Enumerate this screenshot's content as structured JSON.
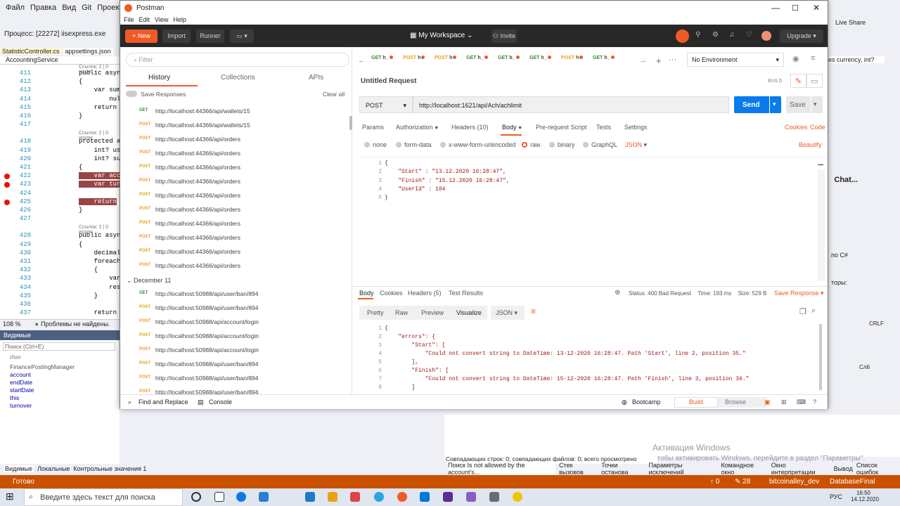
{
  "vs": {
    "menu": [
      "Файл",
      "Правка",
      "Вид",
      "Git",
      "Проект"
    ],
    "process": "Процесс: [22272] iisexpress.exe",
    "tabs": [
      "StatisticController.cs",
      "appsettings.json"
    ],
    "service": "AccountingService",
    "code_lines": [
      {
        "n": "411",
        "t": "public async"
      },
      {
        "n": "412",
        "t": "{"
      },
      {
        "n": "413",
        "t": "    var sum"
      },
      {
        "n": "414",
        "t": "        nul"
      },
      {
        "n": "415",
        "t": "    return"
      },
      {
        "n": "416",
        "t": "}"
      },
      {
        "n": "417",
        "t": ""
      },
      {
        "n": "418",
        "t": "protected a"
      },
      {
        "n": "419",
        "t": "    int? use"
      },
      {
        "n": "420",
        "t": "    int? suc"
      },
      {
        "n": "421",
        "t": "{"
      },
      {
        "n": "422",
        "t": "    var acc"
      },
      {
        "n": "423",
        "t": "    var turi"
      },
      {
        "n": "424",
        "t": ""
      },
      {
        "n": "425",
        "t": "    return"
      },
      {
        "n": "426",
        "t": "}"
      },
      {
        "n": "427",
        "t": ""
      },
      {
        "n": "428",
        "t": "public asyn"
      },
      {
        "n": "429",
        "t": "{"
      },
      {
        "n": "430",
        "t": "    decimal"
      },
      {
        "n": "431",
        "t": "    foreach"
      },
      {
        "n": "432",
        "t": "    {"
      },
      {
        "n": "433",
        "t": "        var"
      },
      {
        "n": "434",
        "t": "        res"
      },
      {
        "n": "435",
        "t": "    }"
      },
      {
        "n": "436",
        "t": ""
      },
      {
        "n": "437",
        "t": "    return"
      }
    ],
    "codelens": "Ссылок: 2 | 0 исклю",
    "zoom": "108 %",
    "no_problems": "Проблемы не найдены.",
    "watch_title": "Видимые",
    "watch_search": "Поиск (Ctrl+E)",
    "watch_col": "Имя",
    "watch_items": [
      "FinancePostingManager",
      "account",
      "endDate",
      "startDate",
      "this",
      "turnover"
    ],
    "bottom_tabs": [
      "Видимые",
      "Локальные",
      "Контрольные значения 1"
    ],
    "bottom_tabs_right": [
      "Стек вызовов",
      "Точки останова",
      "Параметры исключений",
      "Командное окно",
      "Окно интерпретации",
      "Вывод",
      "Список ошибок"
    ],
    "find_results": "Совпадающих строк: 0; совпадающих файлов: 0; всего просмотрено файлов: 128",
    "find_label": "Поиск Is not allowed by the account's...",
    "status_ready": "Готово",
    "status_items": [
      "↑ 0",
      "✎ 28",
      "bitcoinalley_dev",
      "DatabaseFinal"
    ],
    "right_text": [
      "es currency, int?",
      "Chat...",
      "по C#",
      "торы:",
      "CRLF",
      "Сл6"
    ],
    "live_share": "Live Share",
    "activation_title": "Активация Windows",
    "activation_sub": "Чтобы активировать Windows, перейдите в раздел \"Параметры\"."
  },
  "taskbar": {
    "search_placeholder": "Введите здесь текст для поиска",
    "lang": "РУС",
    "time": "16:50",
    "date": "14.12.2020"
  },
  "postman": {
    "window_title": "Postman",
    "menu": [
      "File",
      "Edit",
      "View",
      "Help"
    ],
    "new_label": "New",
    "import_label": "Import",
    "runner_label": "Runner",
    "workspace": "My Workspace",
    "invite": "Invite",
    "upgrade": "Upgrade",
    "filter_placeholder": "Filter",
    "sidebar_tabs": [
      "History",
      "Collections",
      "APIs"
    ],
    "save_responses": "Save Responses",
    "clear_all": "Clear all",
    "history": [
      {
        "method": "GET",
        "url": "http://localhost:44366/api/wallets/15"
      },
      {
        "method": "POST",
        "url": "http://localhost:44366/api/wallets/15"
      },
      {
        "method": "POST",
        "url": "http://localhost:44366/api/orders"
      },
      {
        "method": "POST",
        "url": "http://localhost:44366/api/orders"
      },
      {
        "method": "POST",
        "url": "http://localhost:44366/api/orders"
      },
      {
        "method": "POST",
        "url": "http://localhost:44366/api/orders"
      },
      {
        "method": "POST",
        "url": "http://localhost:44366/api/orders"
      },
      {
        "method": "POST",
        "url": "http://localhost:44366/api/orders"
      },
      {
        "method": "POST",
        "url": "http://localhost:44366/api/orders"
      },
      {
        "method": "POST",
        "url": "http://localhost:44366/api/orders"
      },
      {
        "method": "POST",
        "url": "http://localhost:44366/api/orders"
      },
      {
        "method": "POST",
        "url": "http://localhost:44366/api/orders"
      }
    ],
    "history_group": "December 11",
    "history2": [
      {
        "method": "GET",
        "url": "http://localhost:50988/api/user/ban/894"
      },
      {
        "method": "POST",
        "url": "http://localhost:50988/api/user/ban/894"
      },
      {
        "method": "POST",
        "url": "http://localhost:50988/api/account/login"
      },
      {
        "method": "POST",
        "url": "http://localhost:50988/api/account/login"
      },
      {
        "method": "POST",
        "url": "http://localhost:50988/api/account/login"
      },
      {
        "method": "POST",
        "url": "http://localhost:50988/api/user/ban/894"
      },
      {
        "method": "POST",
        "url": "http://localhost:50988/api/user/ban/894"
      },
      {
        "method": "POST",
        "url": "http://localhost:50988/api/user/ban/894"
      }
    ],
    "req_tabs": [
      {
        "m": "GET",
        "l": "h_"
      },
      {
        "m": "POST",
        "l": "h"
      },
      {
        "m": "POST",
        "l": "h"
      },
      {
        "m": "GET",
        "l": "h_"
      },
      {
        "m": "GET",
        "l": "b_"
      },
      {
        "m": "GET",
        "l": "h_"
      },
      {
        "m": "POST",
        "l": "h"
      },
      {
        "m": "GET",
        "l": "h_"
      }
    ],
    "environment": "No Environment",
    "request_name": "Untitled Request",
    "build": "BUILD",
    "method": "POST",
    "url": "http://localhost:1621/api/Ach/achlimit",
    "send": "Send",
    "save": "Save",
    "request_tabs": [
      "Params",
      "Authorization",
      "Headers (10)",
      "Body",
      "Pre-request Script",
      "Tests",
      "Settings"
    ],
    "cookies": "Cookies",
    "code": "Code",
    "body_types": [
      "none",
      "form-data",
      "x-www-form-urlencoded",
      "raw",
      "binary",
      "GraphQL"
    ],
    "body_format": "JSON",
    "beautify": "Beautify",
    "request_body": [
      {
        "n": "1",
        "t": "{"
      },
      {
        "n": "2",
        "t": "    \"Start\" : \"13.12.2020 16:28:47\","
      },
      {
        "n": "3",
        "t": "    \"Finish\" : \"15.12.2020 16:28:47\","
      },
      {
        "n": "4",
        "t": "    \"UserId\" : 104"
      },
      {
        "n": "5",
        "t": "}"
      }
    ],
    "response_tabs": [
      "Body",
      "Cookies",
      "Headers (5)",
      "Test Results"
    ],
    "status": "Status: 400 Bad Request",
    "time": "Time: 193 ms",
    "size": "Size: 529 B",
    "save_response": "Save Response",
    "view_modes": [
      "Pretty",
      "Raw",
      "Preview",
      "Visualize"
    ],
    "response_format": "JSON",
    "response_body": [
      {
        "n": "1",
        "t": "{"
      },
      {
        "n": "2",
        "t": "    \"errors\": {"
      },
      {
        "n": "3",
        "t": "        \"Start\": ["
      },
      {
        "n": "4",
        "t": "            \"Could not convert string to DateTime: 13-12-2020 16:28:47. Path 'Start', line 2, position 35.\""
      },
      {
        "n": "5",
        "t": "        ],"
      },
      {
        "n": "6",
        "t": "        \"Finish\": ["
      },
      {
        "n": "7",
        "t": "            \"Could not convert string to DateTime: 15-12-2020 16:28:47. Path 'Finish', line 3, position 36.\""
      },
      {
        "n": "8",
        "t": "        ]"
      }
    ],
    "footer_find": "Find and Replace",
    "footer_console": "Console",
    "bootcamp": "Bootcamp",
    "build_tab": "Build",
    "browse_tab": "Browse"
  },
  "colors": {
    "postman_orange": "#ef5b25",
    "send_blue": "#097bed",
    "vs_status": "#ca5100"
  }
}
